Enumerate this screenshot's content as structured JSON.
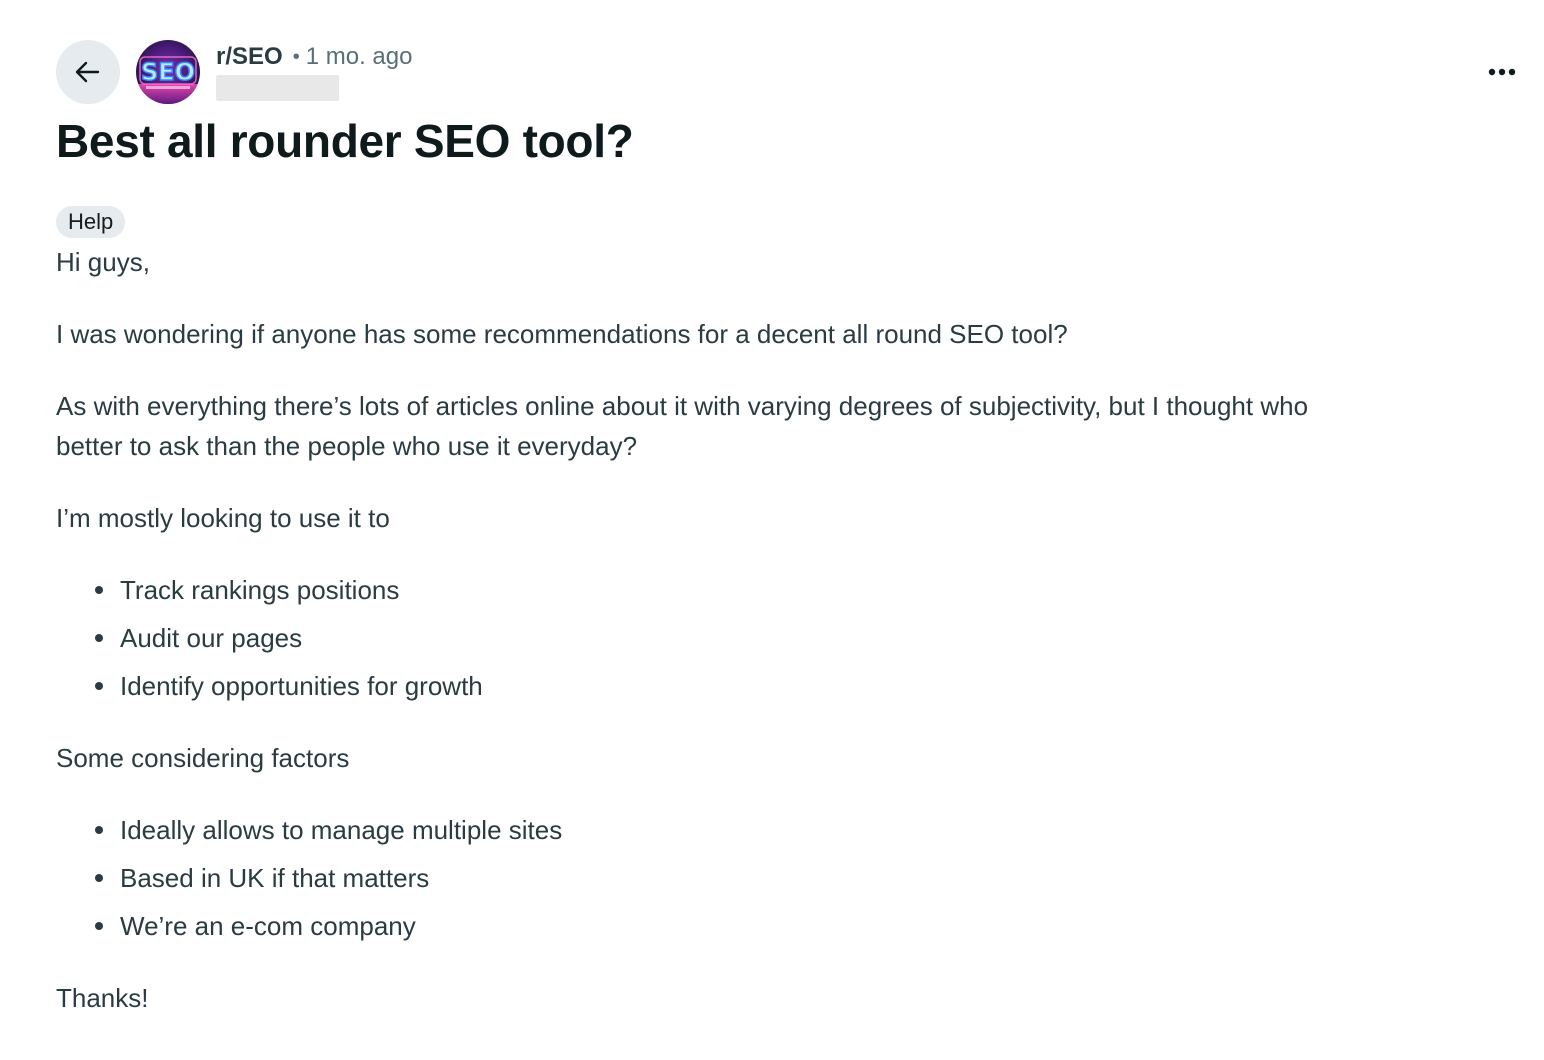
{
  "header": {
    "back_icon": "arrow-left-icon",
    "avatar_icon": "seo-neon-logo",
    "subreddit": "r/SEO",
    "separator": "•",
    "time": "1 mo. ago",
    "more_icon": "more-horizontal-icon"
  },
  "post": {
    "title": "Best all rounder SEO tool?",
    "flair": "Help",
    "paragraphs": {
      "greeting": "Hi guys,",
      "question": "I was wondering if anyone has some recommendations for a decent all round SEO tool?",
      "context_line1": "As with everything there’s lots of articles online about it with varying degrees of subjectivity, but I thought who",
      "context_line2": "better to ask than the people who use it everyday?",
      "uses_intro": "I’m mostly looking to use it to",
      "factors_intro": "Some considering factors",
      "signoff": "Thanks!"
    },
    "uses": [
      "Track rankings positions",
      "Audit our pages",
      "Identify opportunities for growth"
    ],
    "factors": [
      "Ideally allows to manage multiple sites",
      "Based in UK if that matters",
      "We’re an e-com company"
    ]
  },
  "colors": {
    "text_primary": "#0f1a1c",
    "text_body": "#2a3c42",
    "text_meta": "#576f76",
    "button_bg": "#e5ebee",
    "redacted": "#e8e8e8"
  }
}
